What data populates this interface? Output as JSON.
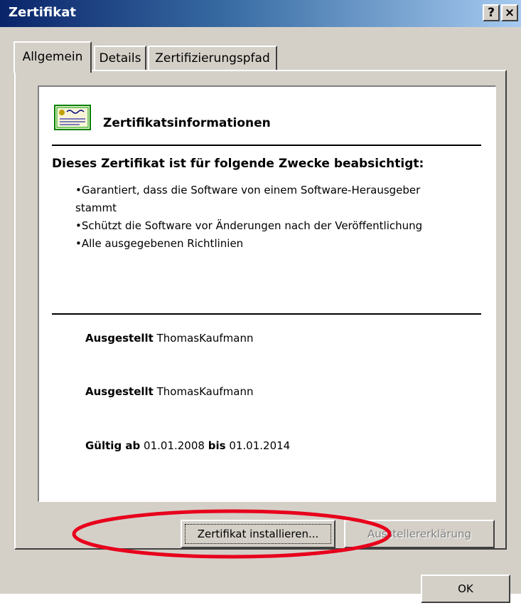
{
  "window": {
    "title": "Zertifikat",
    "help_button": "?",
    "close_button": "×"
  },
  "tabs": [
    {
      "label": "Allgemein",
      "active": true
    },
    {
      "label": "Details",
      "active": false
    },
    {
      "label": "Zertifizierungspfad",
      "active": false
    }
  ],
  "info": {
    "icon": "certificate-icon",
    "heading": "Zertifikatsinformationen",
    "purpose_heading": "Dieses Zertifikat ist für folgende Zwecke beabsichtigt:",
    "purposes": [
      "•Garantiert, dass die Software von einem Software-Herausgeber stammt",
      "•Schützt die Software vor Änderungen nach der Veröffentlichung",
      "•Alle ausgegebenen Richtlinien"
    ],
    "issued_to_label": "Ausgestellt",
    "issued_to_value": "ThomasKaufmann",
    "issued_by_label": "Ausgestellt",
    "issued_by_value": "ThomasKaufmann",
    "valid_from_label": "Gültig ab",
    "valid_from_value": "01.01.2008",
    "valid_to_label": "bis",
    "valid_to_value": "01.01.2014"
  },
  "buttons": {
    "install": "Zertifikat installieren...",
    "issuer_statement": "Ausstellererklärung",
    "ok": "OK"
  },
  "colors": {
    "titlebar_start": "#0a246a",
    "titlebar_end": "#a6caf0",
    "dialog_bg": "#d4d0c8",
    "annotation": "#e8001c"
  }
}
